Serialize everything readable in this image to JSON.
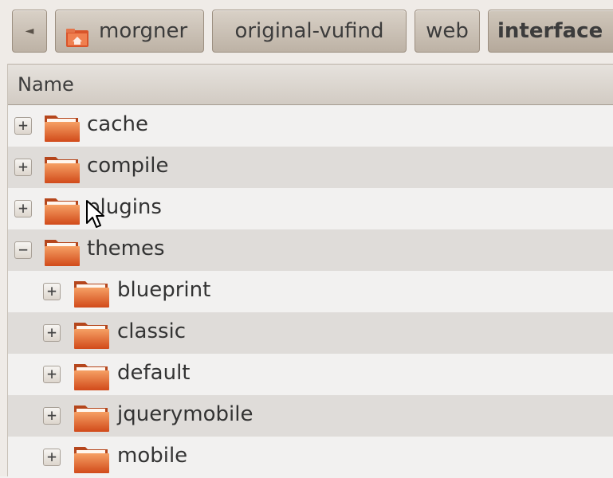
{
  "breadcrumb": {
    "back_label": "◄",
    "items": [
      "morgner",
      "original-vufind",
      "web",
      "interface"
    ]
  },
  "column_header": {
    "name": "Name"
  },
  "tree": [
    {
      "label": "cache",
      "expander": "+"
    },
    {
      "label": "compile",
      "expander": "+"
    },
    {
      "label": "plugins",
      "expander": "+"
    },
    {
      "label": "themes",
      "expander": "−"
    },
    {
      "label": "blueprint",
      "expander": "+"
    },
    {
      "label": "classic",
      "expander": "+"
    },
    {
      "label": "default",
      "expander": "+"
    },
    {
      "label": "jquerymobile",
      "expander": "+"
    },
    {
      "label": "mobile",
      "expander": "+"
    }
  ],
  "colors": {
    "folder_top": "#f6a064",
    "folder_bottom": "#d14a1a",
    "row_alt": "#dfdcd9",
    "row_plain": "#f2f1f0"
  }
}
